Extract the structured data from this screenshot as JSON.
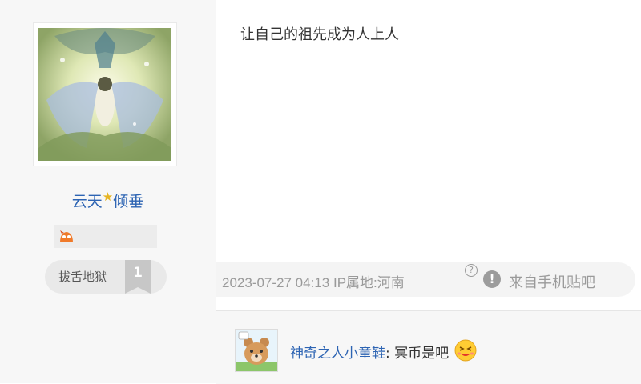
{
  "user": {
    "name_part1": "云天",
    "name_star": "★",
    "name_part2": "倾垂",
    "level_name": "拔舌地狱",
    "level_number": "1"
  },
  "post": {
    "text": "让自己的祖先成为人上人",
    "datetime": "2023-07-27 04:13",
    "ip_location": "IP属地:河南",
    "help_glyph": "?",
    "warn_glyph": "!",
    "source": "来自手机贴吧"
  },
  "comment": {
    "username": "神奇之人小童鞋",
    "separator": ": ",
    "text": "冥币是吧"
  },
  "colors": {
    "link_blue": "#2d64b3",
    "meta_gray": "#9a9a9a",
    "sidebar_bg": "#f7f7f7"
  },
  "icons": [
    "avatar-image",
    "badge-icon",
    "level-flag-icon",
    "help-icon",
    "warning-icon",
    "comment-avatar-bear",
    "emoji-icon"
  ]
}
